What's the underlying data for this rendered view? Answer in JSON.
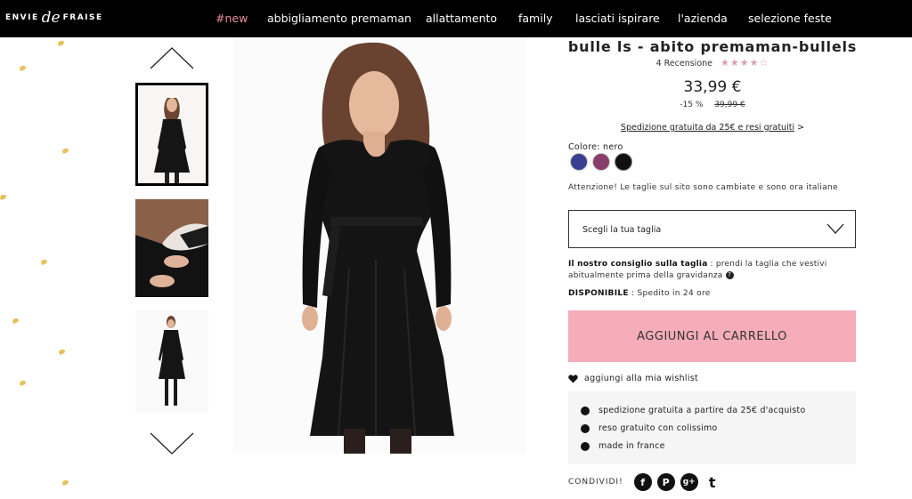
{
  "header": {
    "logo_left": "ENVIE",
    "logo_mark": "de",
    "logo_right": "FRAISE",
    "nav": [
      {
        "label": "#new",
        "accent": true
      },
      {
        "label": "abbigliamento premaman"
      },
      {
        "label": "allattamento"
      },
      {
        "label": "family"
      },
      {
        "label": "lasciati ispirare"
      },
      {
        "label": "l'azienda"
      },
      {
        "label": "selezione feste"
      }
    ]
  },
  "gallery": {
    "up_icon": "chevron-up-icon",
    "down_icon": "chevron-down-icon"
  },
  "product": {
    "title": "bulle ls - abito premaman-bullels",
    "reviews": "4 Recensione",
    "rating": 4,
    "rating_max": 5,
    "price": "33,99 €",
    "discount": "-15 %",
    "old_price": "39,99 €",
    "shipping_link": "Spedizione gratuita da 25€ e resi gratuiti",
    "shipping_arrow": ">",
    "color_label": "Colore: nero",
    "swatches": [
      "#3a3f8f",
      "#8a3f6a",
      "#111111"
    ],
    "size_warning": "Attenzione! Le taglie sul sito sono cambiate e sono ora italiane",
    "size_placeholder": "Scegli la tua taglia",
    "advice_bold": "Il nostro consiglio sulla taglia",
    "advice_text": " : prendi la taglia che vestivi abitualmente prima della gravidanza",
    "avail_bold": "DISPONIBILE",
    "avail_text": " : Spedito in 24 ore",
    "cart_button": "AGGIUNGI AL CARRELLO",
    "wishlist": "aggiungi alla mia wishlist",
    "benefits": [
      "spedizione gratuita a partire da 25€ d'acquisto",
      "reso gratuito con colissimo",
      "made in france"
    ],
    "share_label": "CONDIVIDI!",
    "social": [
      {
        "glyph": "f",
        "icon": "facebook-icon"
      },
      {
        "glyph": "P",
        "icon": "pinterest-icon"
      },
      {
        "glyph": "g+",
        "icon": "google-plus-icon"
      },
      {
        "glyph": "t",
        "icon": "twitter-icon"
      }
    ]
  },
  "colors": {
    "accent": "#e88ea0",
    "cart_button": "#f4adb9"
  }
}
